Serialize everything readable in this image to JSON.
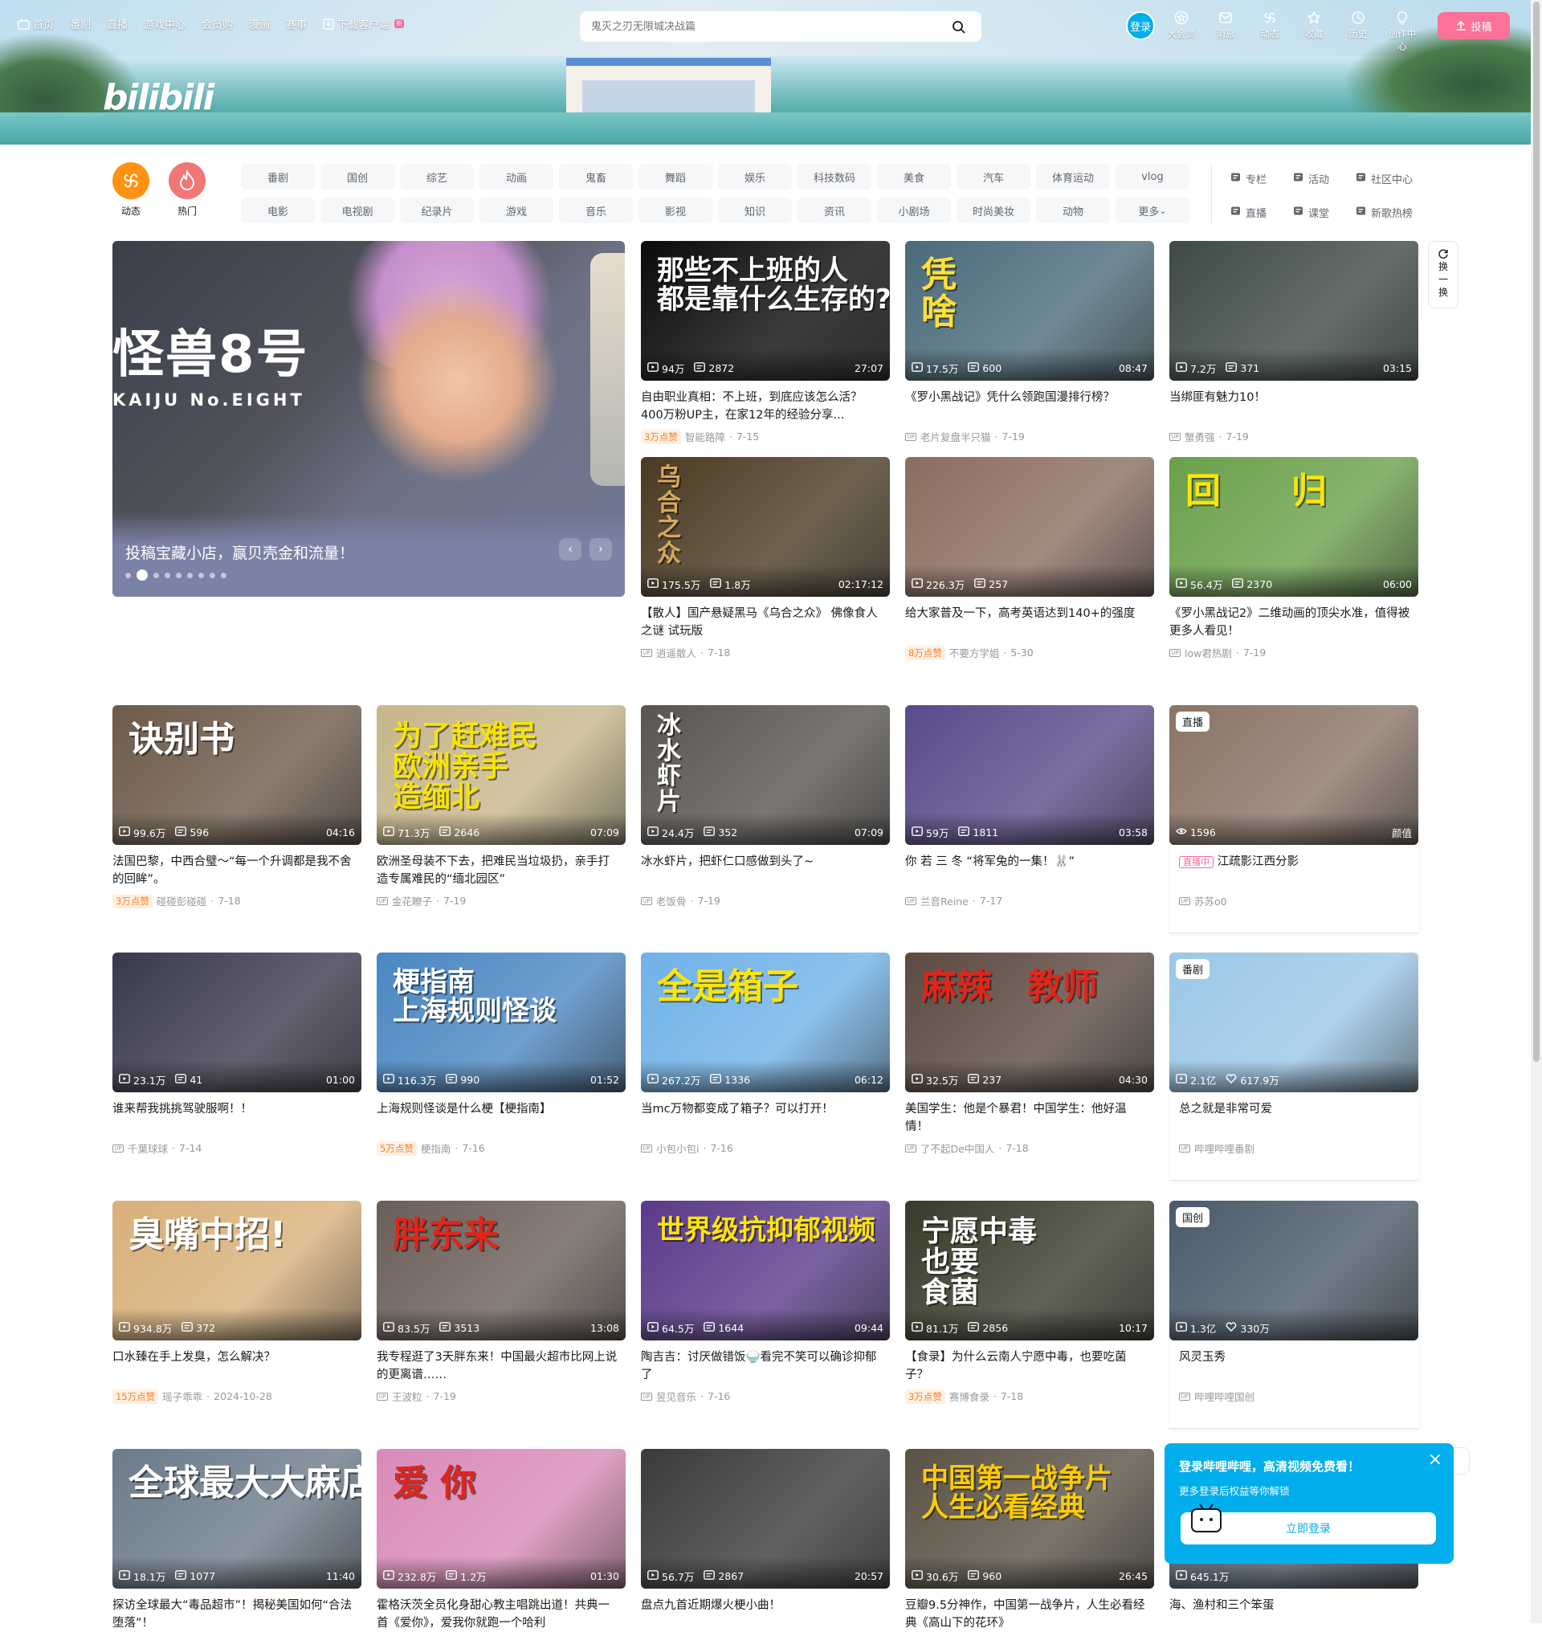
{
  "topnav": {
    "items": [
      {
        "label": "首页"
      },
      {
        "label": "番剧"
      },
      {
        "label": "直播"
      },
      {
        "label": "游戏中心"
      },
      {
        "label": "会员购"
      },
      {
        "label": "漫画"
      },
      {
        "label": "赛事"
      },
      {
        "label": "下载客户端"
      }
    ],
    "new_badge": "新"
  },
  "logo": "bilibili",
  "search": {
    "placeholder": "鬼灭之刃无限城决战篇"
  },
  "login": "登录",
  "righticons": [
    {
      "label": "大会员",
      "icon": "vip-icon"
    },
    {
      "label": "消息",
      "icon": "message-icon"
    },
    {
      "label": "动态",
      "icon": "dynamic-icon"
    },
    {
      "label": "收藏",
      "icon": "star-icon"
    },
    {
      "label": "历史",
      "icon": "clock-icon"
    },
    {
      "label": "创作中心",
      "icon": "bulb-icon"
    }
  ],
  "upload": "投稿",
  "channels": {
    "circles": [
      {
        "label": "动态",
        "color": "#ff9212"
      },
      {
        "label": "热门",
        "color": "#f07775"
      }
    ],
    "tags": [
      "番剧",
      "国创",
      "综艺",
      "动画",
      "鬼畜",
      "舞蹈",
      "娱乐",
      "科技数码",
      "美食",
      "汽车",
      "体育运动",
      "vlog",
      "电影",
      "电视剧",
      "纪录片",
      "游戏",
      "音乐",
      "影视",
      "知识",
      "资讯",
      "小剧场",
      "时尚美妆",
      "动物",
      "更多"
    ],
    "quick": [
      {
        "label": "专栏",
        "icon": "column-icon"
      },
      {
        "label": "活动",
        "icon": "flag-icon"
      },
      {
        "label": "社区中心",
        "icon": "community-icon"
      },
      {
        "label": "直播",
        "icon": "live-icon"
      },
      {
        "label": "课堂",
        "icon": "class-icon"
      },
      {
        "label": "新歌热榜",
        "icon": "music-icon"
      }
    ]
  },
  "carousel": {
    "title": "投稿宝藏小店，赢贝壳金和流量！",
    "line1": "怪兽8号",
    "line2": "KAIJU No.EIGHT",
    "dot_count": 9,
    "active_dot": 1
  },
  "refresh": [
    "换",
    "一",
    "换"
  ],
  "cards": [
    {
      "bg": "#0a0a0a",
      "text": "那些不上班的人\n都是靠什么生存的?",
      "textcolor": "#ffffff",
      "views": "94万",
      "danmaku": "2872",
      "duration": "27:07",
      "title": "自由职业真相：不上班，到底应该怎么活？400万粉UP主，在家12年的经验分享...",
      "likes": "3万点赞",
      "author": "智能路障",
      "date": "7-15"
    },
    {
      "bg": "#4b6b7a",
      "text": "凭\n啥",
      "textcolor": "#ffe033",
      "views": "17.5万",
      "danmaku": "600",
      "duration": "08:47",
      "title": "《罗小黑战记》凭什么领跑国漫排行榜？",
      "likes": "",
      "author": "老片复盘半只猫",
      "date": "7-19"
    },
    {
      "bg": "#3d4a47",
      "text": "",
      "textcolor": "#ffffff",
      "views": "7.2万",
      "danmaku": "371",
      "duration": "03:15",
      "title": "当绑匪有魅力10！",
      "likes": "",
      "author": "蟹勇强",
      "date": "7-19"
    },
    {
      "bg": "#4a3a22",
      "text": "乌\n合\n之\n众",
      "textcolor": "#d7a85b",
      "views": "175.5万",
      "danmaku": "1.8万",
      "duration": "02:17:12",
      "title": "【散人】国产悬疑黑马《乌合之众》 佛像食人之谜 试玩版",
      "likes": "",
      "author": "逍遥散人",
      "date": "7-18"
    },
    {
      "bg": "#8b6d60",
      "text": "",
      "textcolor": "#ffffff",
      "views": "226.3万",
      "danmaku": "257",
      "duration": "",
      "title": "给大家普及一下，高考英语达到140+的强度",
      "likes": "8万点赞",
      "author": "不要方学姐",
      "date": "5-30"
    },
    {
      "bg": "#6aa04a",
      "text": "回　　归",
      "textcolor": "#ffe600",
      "views": "56.4万",
      "danmaku": "2370",
      "duration": "06:00",
      "title": "《罗小黑战记2》二维动画的顶尖水准，值得被更多人看见！",
      "likes": "",
      "author": "low君热剧",
      "date": "7-19"
    },
    {
      "bg": "#6d5a4a",
      "text": "诀别书",
      "textcolor": "#ffffff",
      "views": "99.6万",
      "danmaku": "596",
      "duration": "04:16",
      "title": "法国巴黎，中西合璧～“每一个升调都是我不舍的回眸”。",
      "likes": "3万点赞",
      "author": "碰碰彭碰碰",
      "date": "7-18"
    },
    {
      "bg": "#c7b68a",
      "text": "为了赶难民\n欧洲亲手\n造缅北",
      "textcolor": "#f7e500",
      "views": "71.3万",
      "danmaku": "2646",
      "duration": "07:09",
      "title": "欧洲圣母装不下去，把难民当垃圾扔，亲手打造专属难民的“缅北园区”",
      "likes": "",
      "author": "金花瞭子",
      "date": "7-19"
    },
    {
      "bg": "#585450",
      "text": "冰\n水\n虾\n片",
      "textcolor": "#ffffff",
      "views": "24.4万",
      "danmaku": "352",
      "duration": "07:09",
      "title": "冰水虾片，把虾仁口感做到头了~",
      "likes": "",
      "author": "老饭骨",
      "date": "7-19"
    },
    {
      "bg": "#5a4a8a",
      "text": "",
      "textcolor": "#ffffff",
      "views": "59万",
      "danmaku": "1811",
      "duration": "03:58",
      "title": "你 若 三 冬 “将军兔的一集！🐰”",
      "likes": "",
      "author": "兰音Reine",
      "date": "7-17"
    },
    {
      "bg": "#8a7466",
      "text": "",
      "textcolor": "#ffffff",
      "badge": "直播",
      "views": "1596",
      "danmaku": "",
      "duration": "颜值",
      "title": "江疏影江西分影",
      "live": "直播中",
      "likes": "",
      "author": "苏苏o0",
      "date": ""
    },
    {
      "bg": "#39394d",
      "text": "",
      "textcolor": "#ffffff",
      "views": "23.1万",
      "danmaku": "41",
      "duration": "01:00",
      "title": "谁来帮我挑挑驾驶服啊！！",
      "likes": "",
      "author": "千葉球球",
      "date": "7-14"
    },
    {
      "bg": "#4a87c2",
      "text": "梗指南\n上海规则怪谈",
      "textcolor": "#ffffff",
      "views": "116.3万",
      "danmaku": "990",
      "duration": "01:52",
      "title": "上海规则怪谈是什么梗【梗指南】",
      "likes": "5万点赞",
      "author": "梗指南",
      "date": "7-16"
    },
    {
      "bg": "#6fb2e8",
      "text": "全是箱子",
      "textcolor": "#ffe600",
      "views": "267.2万",
      "danmaku": "1336",
      "duration": "06:12",
      "title": "当mc万物都变成了箱子？可以打开！",
      "likes": "",
      "author": "小包小包i",
      "date": "7-16"
    },
    {
      "bg": "#5b4a40",
      "text": "麻辣　教师",
      "textcolor": "#e0251b",
      "views": "32.5万",
      "danmaku": "237",
      "duration": "04:30",
      "title": "美国学生：他是个暴君！中国学生：他好温情！",
      "likes": "",
      "author": "了不起De中国人",
      "date": "7-18"
    },
    {
      "bg": "#9bc7e8",
      "text": "",
      "textcolor": "#ffffff",
      "badge": "番剧",
      "views": "2.1亿",
      "danmaku": "617.9万",
      "duration": "",
      "title": "总之就是非常可爱",
      "likes": "",
      "author": "哔哩哔哩番剧",
      "date": ""
    },
    {
      "bg": "#d8b07a",
      "text": "臭嘴中招!",
      "textcolor": "#ffffff",
      "views": "934.8万",
      "danmaku": "372",
      "duration": "",
      "title": "口水臻在手上发臭，怎么解决？",
      "likes": "15万点赞",
      "author": "瑶子乖乖",
      "date": "2024-10-28"
    },
    {
      "bg": "#6b5e58",
      "text": "胖东来",
      "textcolor": "#e0251b",
      "views": "83.5万",
      "danmaku": "3513",
      "duration": "13:08",
      "title": "我专程逛了3天胖东来！中国最火超市比网上说的更离谱……",
      "likes": "",
      "author": "王波粒",
      "date": "7-19"
    },
    {
      "bg": "#5a3a8a",
      "text": "世界级抗抑郁视频",
      "textcolor": "#ffe600",
      "views": "64.5万",
      "danmaku": "1644",
      "duration": "09:44",
      "title": "陶吉吉：讨厌做错饭🍚看完不笑可以确诊抑郁了",
      "likes": "",
      "author": "昱见音乐",
      "date": "7-16"
    },
    {
      "bg": "#3a3a2a",
      "text": "宁愿中毒\n也要\n食菌",
      "textcolor": "#ffffff",
      "views": "81.1万",
      "danmaku": "2856",
      "duration": "10:17",
      "title": "【食录】为什么云南人宁愿中毒，也要吃菌子？",
      "likes": "3万点赞",
      "author": "赛博食录",
      "date": "7-18"
    },
    {
      "bg": "#4a5a6a",
      "text": "",
      "textcolor": "#ffffff",
      "badge": "国创",
      "views": "1.3亿",
      "danmaku": "330万",
      "duration": "",
      "title": "风灵玉秀",
      "likes": "",
      "author": "哔哩哔哩国创",
      "date": ""
    },
    {
      "bg": "#6b7b8a",
      "text": "全球最大大麻店",
      "textcolor": "#ffffff",
      "views": "18.1万",
      "danmaku": "1077",
      "duration": "11:40",
      "title": "探访全球最大“毒品超市”！揭秘美国如何“合法堕落”！",
      "likes": "",
      "author": "",
      "date": ""
    },
    {
      "bg": "#d98ab8",
      "text": "爱 你",
      "textcolor": "#e0251b",
      "views": "232.8万",
      "danmaku": "1.2万",
      "duration": "01:30",
      "title": "霍格沃茨全员化身甜心教主唱跳出道！共典一首《爱你》，爱我你就跑一个哈利",
      "likes": "",
      "author": "",
      "date": ""
    },
    {
      "bg": "#3a3a3a",
      "text": "",
      "textcolor": "#ffffff",
      "views": "56.7万",
      "danmaku": "2867",
      "duration": "20:57",
      "title": "盘点九首近期爆火梗小曲！",
      "likes": "",
      "author": "",
      "date": ""
    },
    {
      "bg": "#5a5244",
      "text": "中国第一战争片\n人生必看经典",
      "textcolor": "#ffcc00",
      "views": "30.6万",
      "danmaku": "960",
      "duration": "26:45",
      "title": "豆瓣9.5分神作，中国第一战争片，人生必看经典《高山下的花环》",
      "likes": "",
      "author": "",
      "date": ""
    },
    {
      "bg": "#5a6a7a",
      "text": "",
      "textcolor": "#ffffff",
      "views": "645.1万",
      "danmaku": "",
      "duration": "",
      "title": "海、渔村和三个笨蛋",
      "likes": "",
      "author": "",
      "date": ""
    }
  ],
  "loginpop": {
    "title": "登录哔哩哔哩，高清视频免费看！",
    "subtitle": "更多登录后权益等你解锁",
    "button": "立即登录",
    "close": "×"
  }
}
